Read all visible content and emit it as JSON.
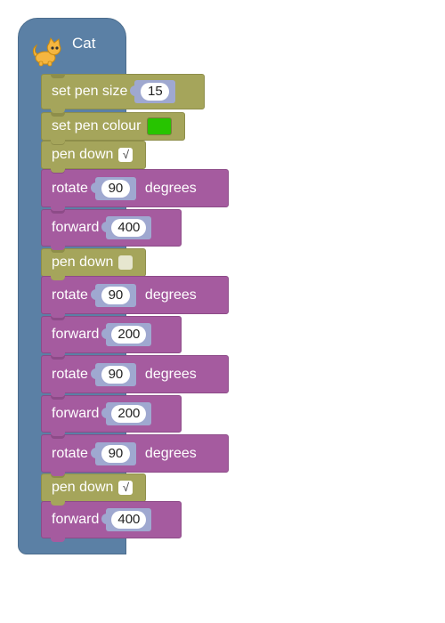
{
  "sprite": {
    "name": "Cat",
    "icon": "cat-icon"
  },
  "blocks": [
    {
      "type": "pen",
      "label": "set pen size",
      "value": "15"
    },
    {
      "type": "pen",
      "label": "set pen colour",
      "colour": "#27c400"
    },
    {
      "type": "pen",
      "label": "pen down",
      "checked": true
    },
    {
      "type": "motion",
      "label": "rotate",
      "value": "90",
      "unit": "degrees"
    },
    {
      "type": "motion",
      "label": "forward",
      "value": "400"
    },
    {
      "type": "pen",
      "label": "pen down",
      "checked": false
    },
    {
      "type": "motion",
      "label": "rotate",
      "value": "90",
      "unit": "degrees"
    },
    {
      "type": "motion",
      "label": "forward",
      "value": "200"
    },
    {
      "type": "motion",
      "label": "rotate",
      "value": "90",
      "unit": "degrees"
    },
    {
      "type": "motion",
      "label": "forward",
      "value": "200"
    },
    {
      "type": "motion",
      "label": "rotate",
      "value": "90",
      "unit": "degrees"
    },
    {
      "type": "pen",
      "label": "pen down",
      "checked": true
    },
    {
      "type": "motion",
      "label": "forward",
      "value": "400"
    }
  ],
  "check_glyph": "√",
  "colors": {
    "sprite": "#5b80a5",
    "pen": "#a5a55b",
    "motion": "#a55b9f",
    "slot": "#9fa8d0"
  }
}
